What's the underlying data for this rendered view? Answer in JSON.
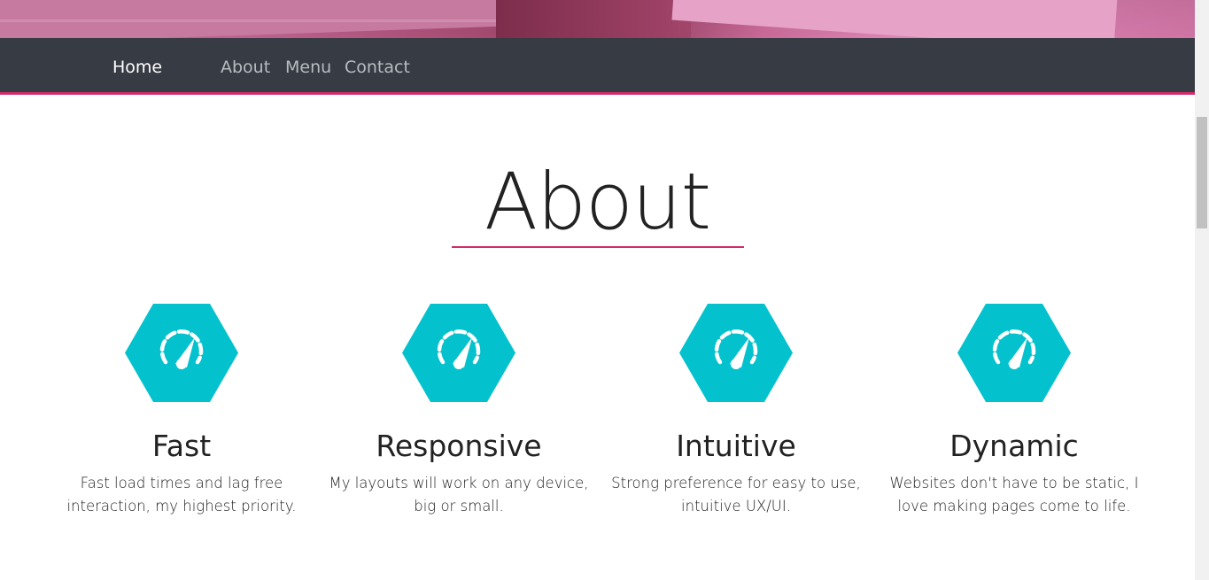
{
  "nav": {
    "links": [
      {
        "label": "Home",
        "active": true
      },
      {
        "label": "About",
        "active": false
      },
      {
        "label": "Menu",
        "active": false
      },
      {
        "label": "Contact",
        "active": false
      }
    ]
  },
  "about": {
    "title": "About"
  },
  "features": [
    {
      "title": "Fast",
      "line1": "Fast load times and lag free",
      "line2": "interaction, my highest priority.",
      "icon": "speedometer-icon"
    },
    {
      "title": "Responsive",
      "line1": "My layouts will work on any device,",
      "line2": "big or small.",
      "icon": "speedometer-icon"
    },
    {
      "title": "Intuitive",
      "line1": "Strong preference for easy to use,",
      "line2": "intuitive UX/UI.",
      "icon": "speedometer-icon"
    },
    {
      "title": "Dynamic",
      "line1": "Websites don't have to be static, I",
      "line2": "love making pages come to life.",
      "icon": "speedometer-icon"
    }
  ],
  "colors": {
    "accent": "#d22a6c",
    "hex": "#04c2cd",
    "navbar": "#373b43"
  }
}
